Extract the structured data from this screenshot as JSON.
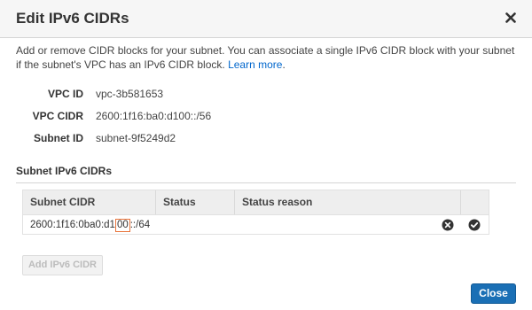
{
  "dialog": {
    "title": "Edit IPv6 CIDRs",
    "close_icon": "close-x-icon"
  },
  "description": {
    "text": "Add or remove CIDR blocks for your subnet. You can associate a single IPv6 CIDR block with your subnet if the subnet's VPC has an IPv6 CIDR block.",
    "link_label": "Learn more",
    "suffix": "."
  },
  "info": {
    "vpc_id_label": "VPC ID",
    "vpc_id_value": "vpc-3b581653",
    "vpc_cidr_label": "VPC CIDR",
    "vpc_cidr_value": "2600:1f16:ba0:d100::/56",
    "subnet_id_label": "Subnet ID",
    "subnet_id_value": "subnet-9f5249d2"
  },
  "section": {
    "title": "Subnet IPv6 CIDRs"
  },
  "table": {
    "columns": [
      "Subnet CIDR",
      "Status",
      "Status reason"
    ],
    "rows": [
      {
        "cidr_prefix": "2600:1f16:0ba0:d1",
        "cidr_edit": "00",
        "cidr_suffix": "::/64",
        "status": "",
        "status_reason": ""
      }
    ],
    "remove_icon": "remove-circle-icon",
    "confirm_icon": "check-circle-icon"
  },
  "buttons": {
    "add_label": "Add IPv6 CIDR",
    "close_label": "Close"
  },
  "colors": {
    "accent": "#1a6fb5",
    "link": "#0066cc",
    "highlight_border": "#e8733a"
  }
}
